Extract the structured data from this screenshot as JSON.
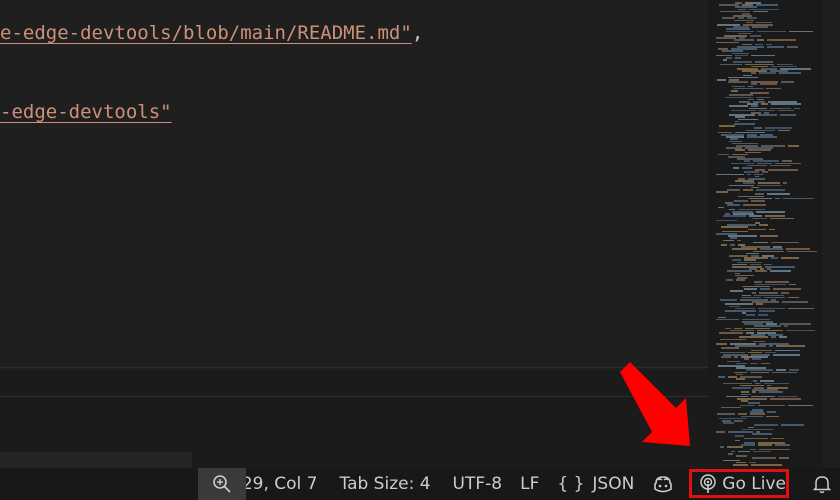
{
  "editor": {
    "line1_string": "e-edge-devtools/blob/main/README.md",
    "line1_quote": "\"",
    "line1_suffix": ",",
    "line2_string": "-edge-devtools",
    "line2_quote": "\""
  },
  "statusbar": {
    "zoom_icon": "zoom-in-icon",
    "position": "Ln 29, Col 7",
    "tab_size": "Tab Size: 4",
    "encoding": "UTF-8",
    "eol": "LF",
    "language_braces": "{ }",
    "language": "JSON",
    "copilot_icon": "copilot-icon",
    "go_live_icon": "broadcast-icon",
    "go_live": "Go Live",
    "notifications_icon": "bell-icon"
  },
  "colors": {
    "string": "#ce9178",
    "status_text": "#cccccc",
    "highlight": "#e01010",
    "arrow": "#ff0000"
  }
}
